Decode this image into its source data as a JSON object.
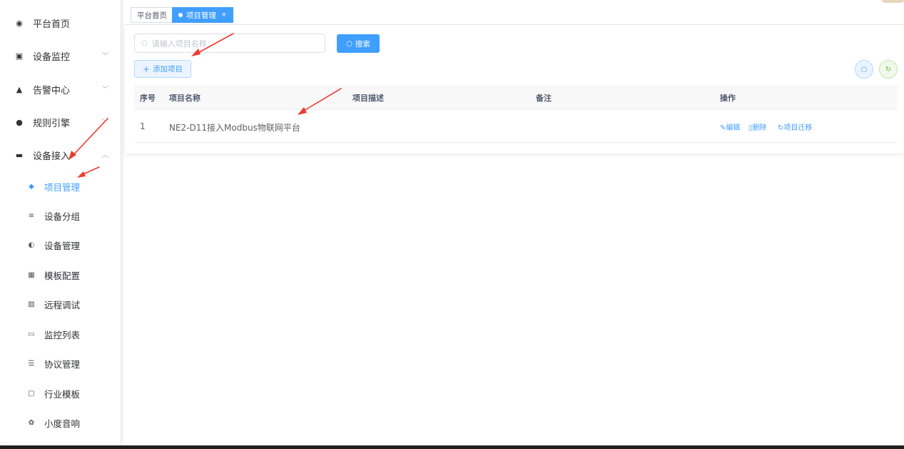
{
  "sidebar": {
    "items": [
      {
        "label": "平台首页",
        "icon": "dashboard-icon",
        "expandable": false
      },
      {
        "label": "设备监控",
        "icon": "monitor-icon",
        "expandable": true
      },
      {
        "label": "告警中心",
        "icon": "alarm-icon",
        "expandable": true
      },
      {
        "label": "规则引擎",
        "icon": "rule-icon",
        "expandable": true
      },
      {
        "label": "设备接入",
        "icon": "server-icon",
        "expandable": true,
        "expanded": true
      }
    ],
    "sub_items": [
      {
        "label": "项目管理",
        "icon": "layers-icon",
        "active": true
      },
      {
        "label": "设备分组",
        "icon": "group-icon"
      },
      {
        "label": "设备管理",
        "icon": "toggle-icon"
      },
      {
        "label": "模板配置",
        "icon": "grid-icon"
      },
      {
        "label": "远程调试",
        "icon": "debug-icon"
      },
      {
        "label": "监控列表",
        "icon": "video-icon"
      },
      {
        "label": "协议管理",
        "icon": "list-icon"
      },
      {
        "label": "行业模板",
        "icon": "template-icon"
      },
      {
        "label": "小度音响",
        "icon": "speaker-icon"
      }
    ]
  },
  "tags": [
    {
      "label": "平台首页",
      "active": false
    },
    {
      "label": "项目管理",
      "active": true,
      "close": "×"
    }
  ],
  "toolbar": {
    "search_placeholder": "请输入项目名称",
    "search_label": "搜索",
    "add_label": "添加项目"
  },
  "table": {
    "headers": [
      "序号",
      "项目名称",
      "项目描述",
      "备注",
      "操作"
    ],
    "rows": [
      {
        "index": "1",
        "name": "NE2-D11接入Modbus物联网平台",
        "desc": "",
        "remark": ""
      }
    ],
    "actions": [
      "编辑",
      "删除",
      "项目迁移"
    ]
  },
  "colors": {
    "primary": "#409eff",
    "success": "#67c23a",
    "annotation_arrow": "#f03a2e"
  }
}
